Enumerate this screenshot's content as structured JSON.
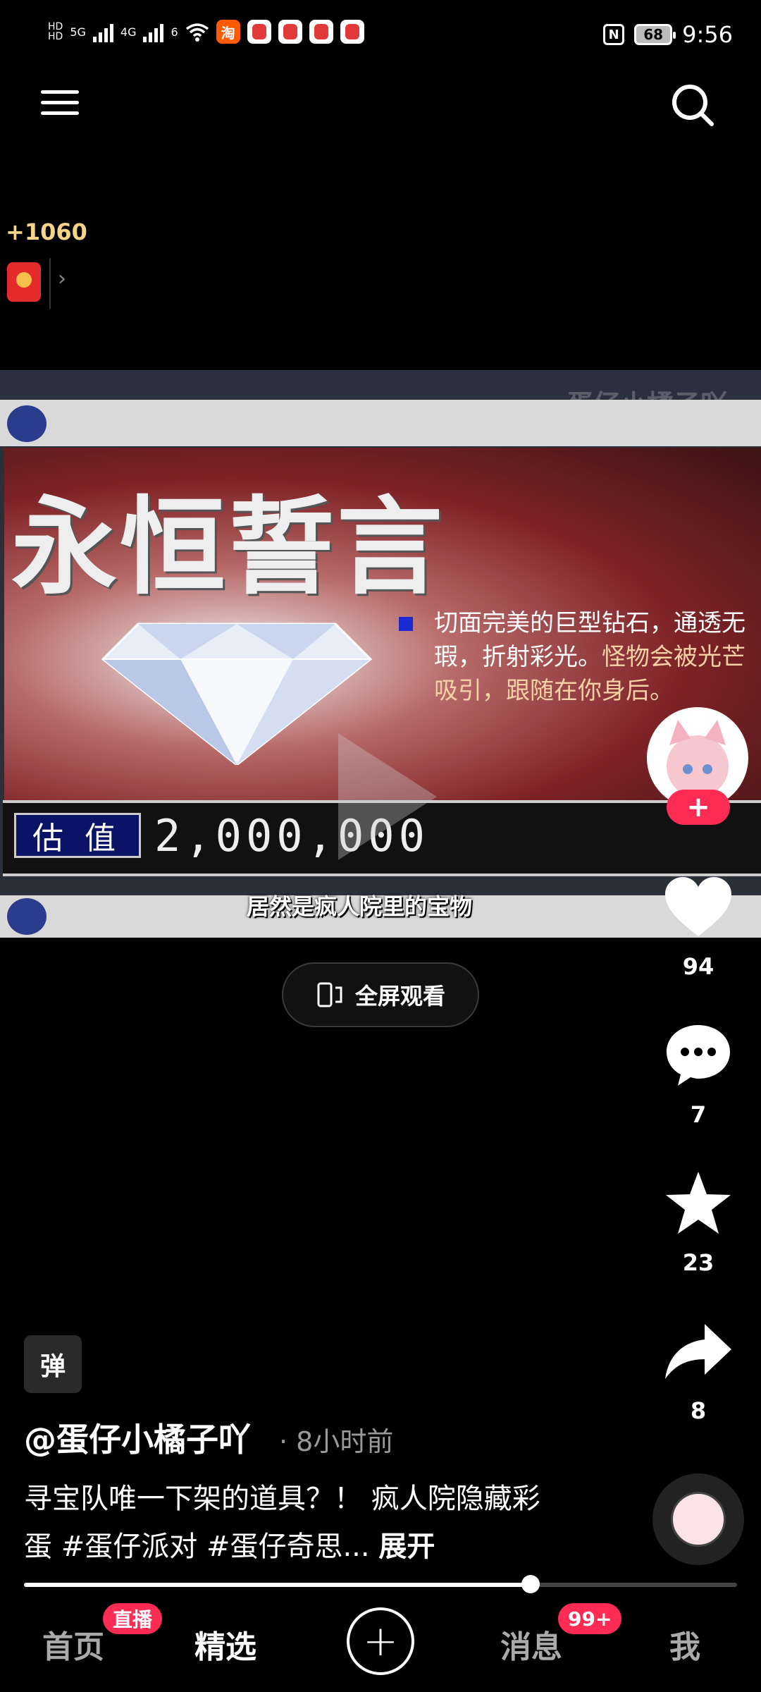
{
  "status_bar": {
    "network": [
      "5G",
      "4G",
      "6"
    ],
    "app_icon_text": "淘",
    "battery": "68",
    "time": "9:56",
    "nfc": "N"
  },
  "coin": {
    "text": "+1060"
  },
  "video": {
    "watermark": "蛋仔小橘子吖",
    "slide_title": "永恒誓言",
    "slide_desc_1": "切面完美的巨型钻石，通透无瑕，折射彩光。",
    "slide_desc_2": "怪物会被光芒吸引，跟随在你身后。",
    "value_label": "估值",
    "value": "2,000,000",
    "subtitle": "居然是疯人院里的宝物"
  },
  "fullscreen": {
    "label": "全屏观看"
  },
  "rail": {
    "follow": "+",
    "likes": "94",
    "comments": "7",
    "favorites": "23",
    "shares": "8"
  },
  "info": {
    "tag": "弹",
    "author": "@蛋仔小橘子吖",
    "time": "· 8小时前",
    "desc": "寻宝队唯一下架的道具？！ 疯人院隐藏彩蛋 #蛋仔派对 #蛋仔奇思...",
    "expand": "展开",
    "progress": 0.71
  },
  "nav": {
    "home": "首页",
    "live_badge": "直播",
    "featured": "精选",
    "add": "+",
    "messages": "消息",
    "msg_badge": "99+",
    "me": "我"
  }
}
